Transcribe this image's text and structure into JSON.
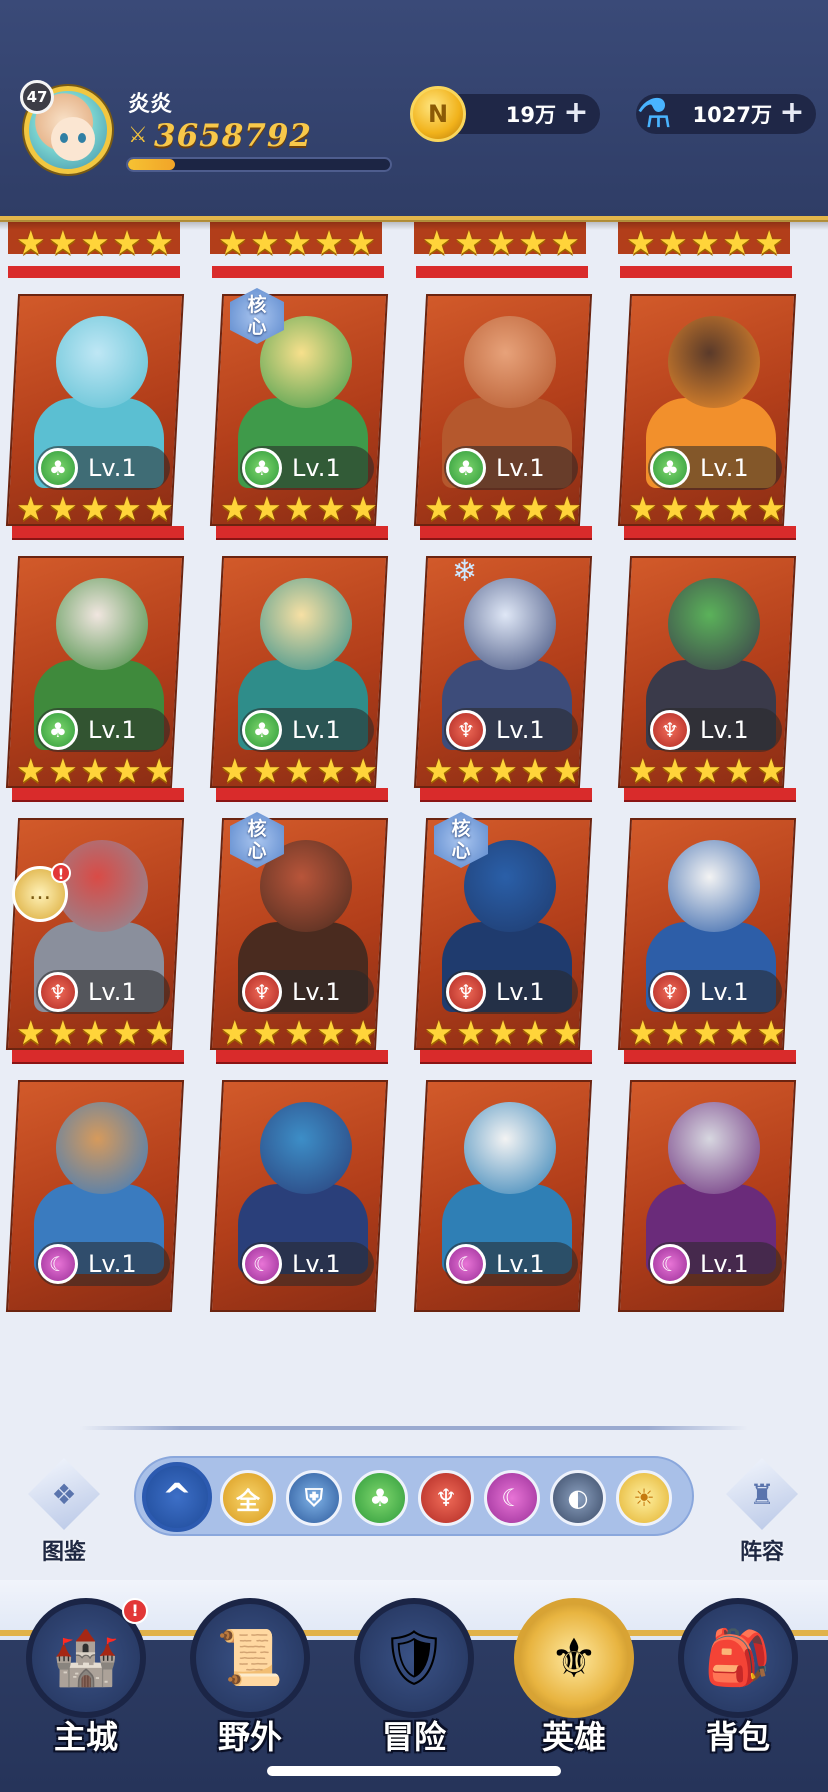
{
  "player": {
    "level": "47",
    "name": "炎炎",
    "power": "3658792",
    "exp_fraction": 0.18
  },
  "currencies": {
    "coins": {
      "value": "19万",
      "icon": "coin-icon",
      "plus": "+"
    },
    "potions": {
      "value": "1027万",
      "icon": "potion-icon",
      "plus": "+"
    }
  },
  "labels": {
    "core_1": "核",
    "core_2": "心",
    "star": "★"
  },
  "heroes": [
    {
      "level": "Lv.1",
      "faction": "nature",
      "faction_icon": "tree-icon",
      "core": false,
      "colors": [
        "#bfe7f5",
        "#5bbfd2"
      ]
    },
    {
      "level": "Lv.1",
      "faction": "nature",
      "faction_icon": "tree-icon",
      "core": true,
      "colors": [
        "#f7e08c",
        "#3f9a4a"
      ]
    },
    {
      "level": "Lv.1",
      "faction": "nature",
      "faction_icon": "tree-icon",
      "core": false,
      "colors": [
        "#e7a27a",
        "#b5582d"
      ]
    },
    {
      "level": "Lv.1",
      "faction": "nature",
      "faction_icon": "tree-icon",
      "core": false,
      "colors": [
        "#5a3a2a",
        "#f2902c"
      ]
    },
    {
      "level": "Lv.1",
      "faction": "nature",
      "faction_icon": "tree-icon",
      "core": false,
      "colors": [
        "#f1e6e0",
        "#3f8a3c"
      ]
    },
    {
      "level": "Lv.1",
      "faction": "nature",
      "faction_icon": "tree-icon",
      "core": false,
      "colors": [
        "#f7e0a4",
        "#2f8d8a"
      ]
    },
    {
      "level": "Lv.1",
      "faction": "fire",
      "faction_icon": "horns-icon",
      "core": false,
      "colors": [
        "#dfe7f6",
        "#3d4c7a"
      ]
    },
    {
      "level": "Lv.1",
      "faction": "fire",
      "faction_icon": "horns-icon",
      "core": false,
      "colors": [
        "#5bb25a",
        "#3a3a4a"
      ]
    },
    {
      "level": "Lv.1",
      "faction": "fire",
      "faction_icon": "horns-icon",
      "core": false,
      "colors": [
        "#d94b46",
        "#8a8f9c"
      ]
    },
    {
      "level": "Lv.1",
      "faction": "fire",
      "faction_icon": "horns-icon",
      "core": true,
      "colors": [
        "#b8553a",
        "#4a2b1f"
      ]
    },
    {
      "level": "Lv.1",
      "faction": "fire",
      "faction_icon": "horns-icon",
      "core": true,
      "colors": [
        "#2a5fa8",
        "#1f3b6e"
      ]
    },
    {
      "level": "Lv.1",
      "faction": "fire",
      "faction_icon": "horns-icon",
      "core": false,
      "colors": [
        "#f3f3f3",
        "#2d5ea8"
      ]
    },
    {
      "level": "Lv.1",
      "faction": "dark",
      "faction_icon": "moon-icon",
      "core": false,
      "colors": [
        "#d69a5c",
        "#3a7bbf"
      ]
    },
    {
      "level": "Lv.1",
      "faction": "dark",
      "faction_icon": "moon-icon",
      "core": false,
      "colors": [
        "#3d8ec7",
        "#2a3f7a"
      ]
    },
    {
      "level": "Lv.1",
      "faction": "dark",
      "faction_icon": "moon-icon",
      "core": false,
      "colors": [
        "#f3f3f3",
        "#2f7fb5"
      ]
    },
    {
      "level": "Lv.1",
      "faction": "dark",
      "faction_icon": "moon-icon",
      "core": false,
      "colors": [
        "#d7d7e0",
        "#6a2b7a"
      ]
    }
  ],
  "filters": [
    {
      "name": "collapse",
      "label": "^",
      "icon": "chevron-up-icon"
    },
    {
      "name": "all",
      "label": "全",
      "icon": "all-icon"
    },
    {
      "name": "tech",
      "label": "",
      "icon": "helmet-icon"
    },
    {
      "name": "nature",
      "label": "",
      "icon": "tree-icon"
    },
    {
      "name": "fire",
      "label": "",
      "icon": "horns-icon"
    },
    {
      "name": "dark",
      "label": "",
      "icon": "moon-icon"
    },
    {
      "name": "void",
      "label": "",
      "icon": "eye-icon"
    },
    {
      "name": "light",
      "label": "",
      "icon": "sun-icon"
    }
  ],
  "side_buttons": {
    "codex": "图鉴",
    "lineup": "阵容"
  },
  "nav": [
    {
      "label": "主城",
      "icon": "castle-icon",
      "alert": "!"
    },
    {
      "label": "野外",
      "icon": "map-scroll-icon",
      "alert": ""
    },
    {
      "label": "冒险",
      "icon": "sword-shield-icon",
      "alert": ""
    },
    {
      "label": "英雄",
      "icon": "hero-helmet-icon",
      "alert": ""
    },
    {
      "label": "背包",
      "icon": "backpack-icon",
      "alert": ""
    }
  ],
  "colors": {
    "header_bg": "#2f3d66",
    "gold_accent": "#e3b64a",
    "card_red": "#b23e1a",
    "star_yellow": "#ffd43a"
  }
}
